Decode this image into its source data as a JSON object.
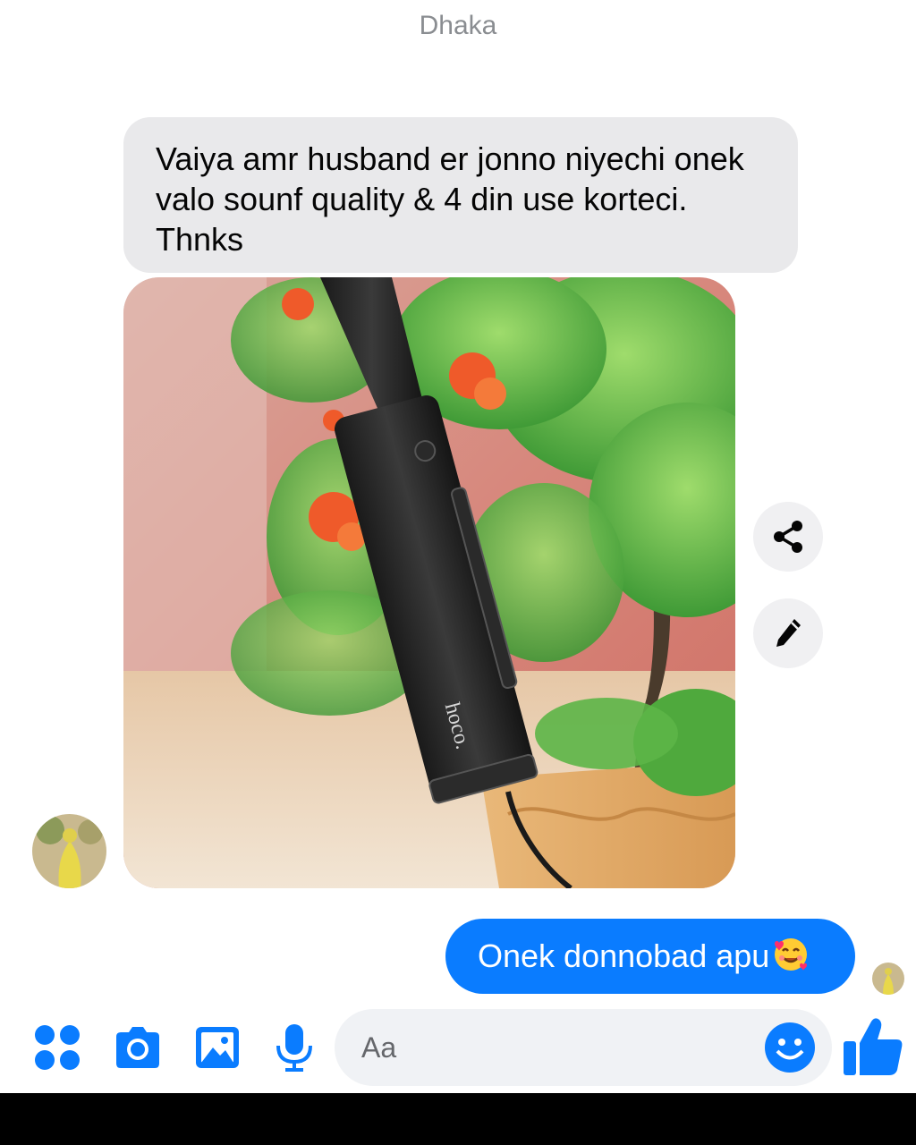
{
  "header": {
    "location": "Dhaka"
  },
  "messages": {
    "incoming_text": "Vaiya amr husband er jonno niyechi onek valo sounf quality & 4 din use korteci. Thnks",
    "photo_brand_text": "hoco.",
    "outgoing_text": "Onek donnobad apu"
  },
  "composer": {
    "placeholder": "Aa",
    "icons": [
      "apps-icon",
      "camera-icon",
      "gallery-icon",
      "microphone-icon",
      "emoji-icon",
      "like-icon"
    ]
  },
  "colors": {
    "accent": "#0a7cff",
    "incoming_bubble": "#e9e9eb",
    "muted_text": "#8a8d91"
  }
}
